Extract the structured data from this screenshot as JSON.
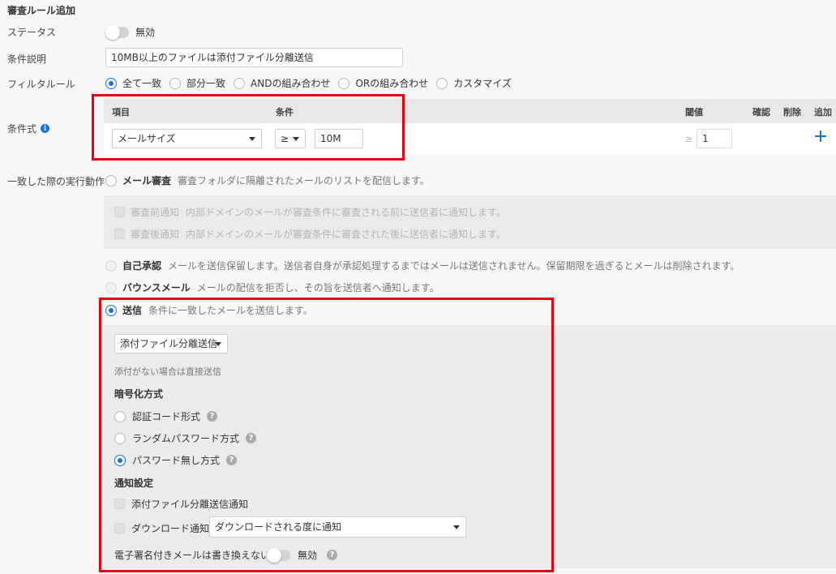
{
  "form": {
    "title": "審査ルール追加",
    "status": {
      "label": "ステータス",
      "toggle_text": "無効"
    },
    "description": {
      "label": "条件説明",
      "value": "10MB以上のファイルは添付ファイル分離送信"
    },
    "filter_rule": {
      "label": "フィルタルール",
      "options": [
        "全て一致",
        "部分一致",
        "ANDの組み合わせ",
        "ORの組み合わせ",
        "カスタマイズ"
      ],
      "selected": "全て一致"
    },
    "condition": {
      "label": "条件式",
      "headers": {
        "item": "項目",
        "cond": "条件",
        "threshold": "閾値",
        "confirm": "確認",
        "delete": "削除",
        "add": "追加"
      },
      "item_value": "メールサイズ",
      "operator_value": "≥",
      "size_value": "10M",
      "threshold_symbol": "≥",
      "threshold_placeholder": "1",
      "add_icon": "plus-icon"
    },
    "action": {
      "label": "一致した際の実行動作",
      "review": {
        "label": "メール審査",
        "desc": "審査フォルダに隔離されたメールのリストを配信します。"
      },
      "pre_notify": {
        "label": "審査前通知",
        "desc": "内部ドメインのメールが審査条件に審査される前に送信者に通知します。"
      },
      "post_notify": {
        "label": "審査後通知",
        "desc": "内部ドメインのメールが審査条件に審査された後に送信者に通知します。"
      },
      "self_approval": {
        "label": "自己承認",
        "desc": "メールを送信保留します。送信者自身が承認処理するまではメールは送信されません。保留期限を過ぎるとメールは削除されます。"
      },
      "bounce": {
        "label": "バウンスメール",
        "desc": "メールの配信を拒否し、その旨を送信者へ通知します。"
      },
      "send": {
        "label": "送信",
        "desc": "条件に一致したメールを送信します。"
      }
    },
    "send_options": {
      "mode_value": "添付ファイル分離送信",
      "hint": "添付がない場合は直接送信",
      "encryption_title": "暗号化方式",
      "encryption_options": [
        "認証コード形式",
        "ランダムパスワード方式",
        "パスワード無し方式"
      ],
      "encryption_selected": "パスワード無し方式",
      "notify_title": "通知設定",
      "notify_attach": "添付ファイル分離送信通知",
      "notify_download": "ダウンロード通知",
      "download_select_value": "ダウンロードされる度に通知",
      "signature_label": "電子署名付きメールは書き換えない:",
      "signature_toggle_text": "無効",
      "help_symbol": "?"
    }
  },
  "colors": {
    "accent": "#1a73d9",
    "highlight": "#e60012",
    "panel": "#ebebeb"
  }
}
